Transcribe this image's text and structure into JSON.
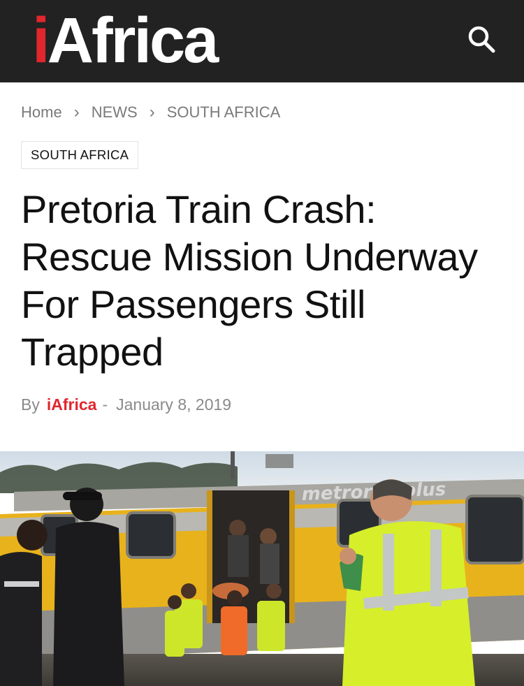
{
  "header": {
    "logo_i": "i",
    "logo_rest": "Africa",
    "search_icon": "search-icon"
  },
  "breadcrumb": [
    "Home",
    "NEWS",
    "SOUTH AFRICA"
  ],
  "category": "SOUTH AFRICA",
  "article": {
    "title": "Pretoria Train Crash: Rescue Mission Underway For Passengers Still Trapped",
    "by": "By",
    "author": "iAfrica",
    "dash": "-",
    "date": "January 8, 2019"
  },
  "hero_image": {
    "train_lettering": "metrorail plus"
  },
  "colors": {
    "brand_red": "#e1262d",
    "topbar": "#222222",
    "train_yellow": "#e8b21c",
    "vest_yellow": "#d6ef2a"
  }
}
